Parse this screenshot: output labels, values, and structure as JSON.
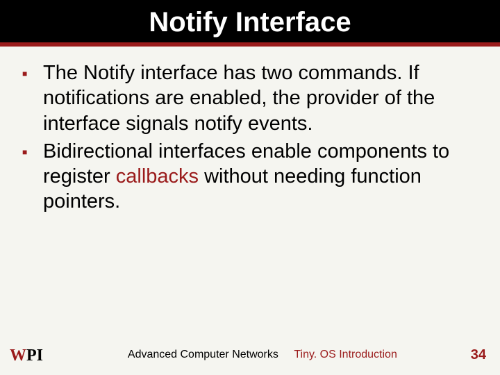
{
  "title": "Notify Interface",
  "bullets": [
    {
      "text": "The Notify interface has two commands. If notifications are enabled, the provider of the interface signals notify events."
    },
    {
      "text_pre": "Bidirectional interfaces enable components to register ",
      "highlight": "callbacks",
      "text_post": " without needing function pointers."
    }
  ],
  "footer": {
    "course": "Advanced Computer Networks",
    "topic": "Tiny. OS Introduction",
    "page": "34"
  },
  "logo": {
    "name": "WPI"
  }
}
